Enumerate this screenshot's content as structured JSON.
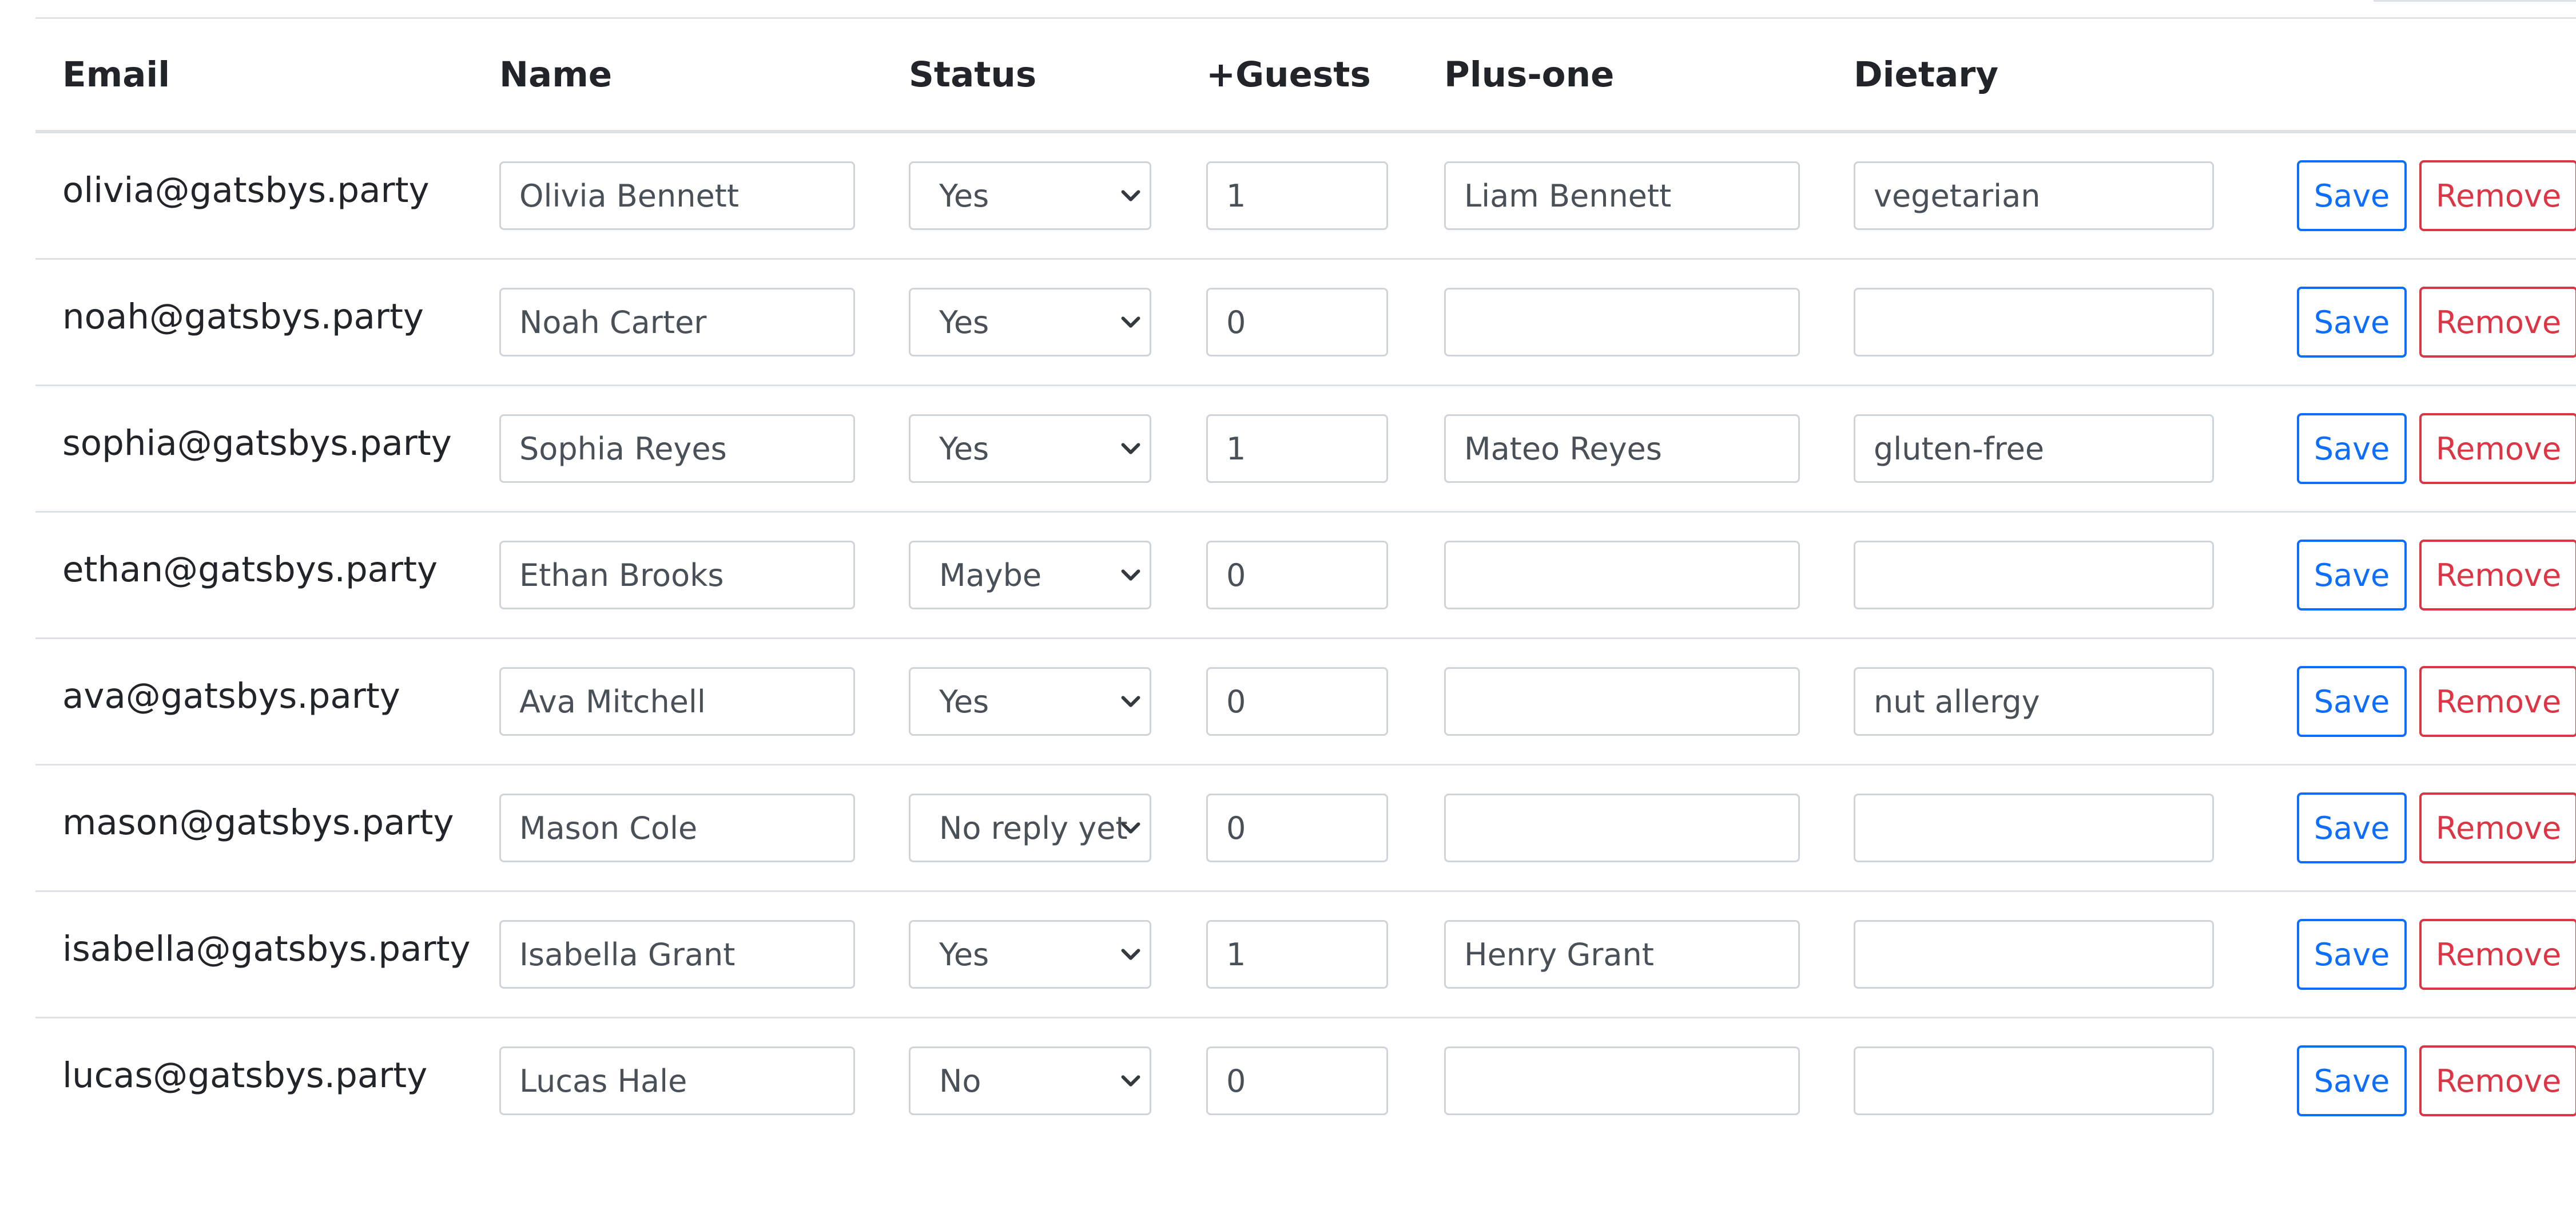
{
  "columns": {
    "email": "Email",
    "name": "Name",
    "status": "Status",
    "guests": "+Guests",
    "plus_one": "Plus-one",
    "dietary": "Dietary"
  },
  "buttons": {
    "save": "Save",
    "remove": "Remove"
  },
  "rows": [
    {
      "email": "olivia@gatsbys.party",
      "name": "Olivia Bennett",
      "status": "Yes",
      "guests": "1",
      "plus_one": "Liam Bennett",
      "dietary": "vegetarian"
    },
    {
      "email": "noah@gatsbys.party",
      "name": "Noah Carter",
      "status": "Yes",
      "guests": "0",
      "plus_one": "",
      "dietary": ""
    },
    {
      "email": "sophia@gatsbys.party",
      "name": "Sophia Reyes",
      "status": "Yes",
      "guests": "1",
      "plus_one": "Mateo Reyes",
      "dietary": "gluten-free"
    },
    {
      "email": "ethan@gatsbys.party",
      "name": "Ethan Brooks",
      "status": "Maybe",
      "guests": "0",
      "plus_one": "",
      "dietary": ""
    },
    {
      "email": "ava@gatsbys.party",
      "name": "Ava Mitchell",
      "status": "Yes",
      "guests": "0",
      "plus_one": "",
      "dietary": "nut allergy"
    },
    {
      "email": "mason@gatsbys.party",
      "name": "Mason Cole",
      "status": "No reply yet",
      "guests": "0",
      "plus_one": "",
      "dietary": ""
    },
    {
      "email": "isabella@gatsbys.party",
      "name": "Isabella Grant",
      "status": "Yes",
      "guests": "1",
      "plus_one": "Henry Grant",
      "dietary": ""
    },
    {
      "email": "lucas@gatsbys.party",
      "name": "Lucas Hale",
      "status": "No",
      "guests": "0",
      "plus_one": "",
      "dietary": ""
    }
  ],
  "colors": {
    "primary": "#0d6efd",
    "danger": "#dc3545",
    "border": "#dee2e6",
    "text": "#212529"
  },
  "icons": {
    "select_arrow": "chevron-down-icon"
  }
}
